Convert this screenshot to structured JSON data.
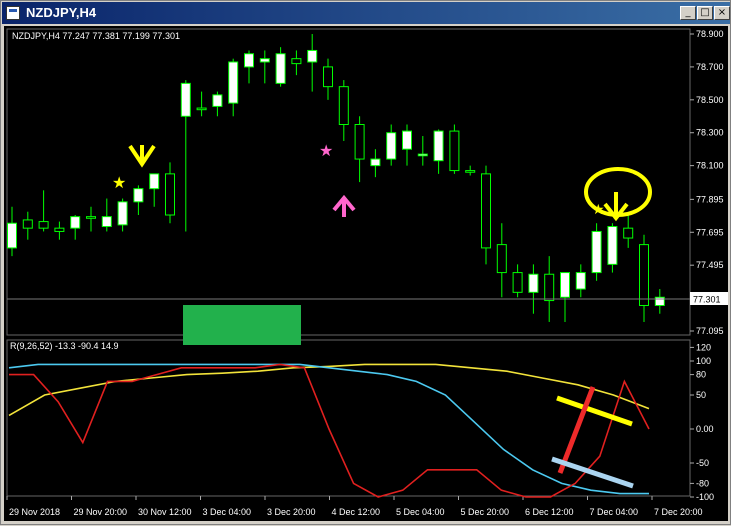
{
  "window": {
    "title": "NZDJPY,H4",
    "buttons": [
      "_",
      "□",
      "×"
    ]
  },
  "main_chart": {
    "header": "NZDJPY,H4  77.247 77.381 77.199 77.301",
    "current_price": "77.301",
    "price_axis": [
      "78.900",
      "78.700",
      "78.500",
      "78.300",
      "78.100",
      "77.895",
      "77.695",
      "77.495",
      "77.295",
      "77.095"
    ],
    "candles": [
      {
        "o": 77.6,
        "h": 77.85,
        "l": 77.55,
        "c": 77.75
      },
      {
        "o": 77.77,
        "h": 77.82,
        "l": 77.65,
        "c": 77.72
      },
      {
        "o": 77.76,
        "h": 77.95,
        "l": 77.7,
        "c": 77.72
      },
      {
        "o": 77.72,
        "h": 77.76,
        "l": 77.65,
        "c": 77.7
      },
      {
        "o": 77.72,
        "h": 77.8,
        "l": 77.65,
        "c": 77.79
      },
      {
        "o": 77.79,
        "h": 77.85,
        "l": 77.7,
        "c": 77.78
      },
      {
        "o": 77.73,
        "h": 77.9,
        "l": 77.7,
        "c": 77.79
      },
      {
        "o": 77.74,
        "h": 77.9,
        "l": 77.7,
        "c": 77.88
      },
      {
        "o": 77.88,
        "h": 77.98,
        "l": 77.8,
        "c": 77.96
      },
      {
        "o": 77.96,
        "h": 78.05,
        "l": 77.85,
        "c": 78.05
      },
      {
        "o": 78.05,
        "h": 78.12,
        "l": 77.75,
        "c": 77.8
      },
      {
        "o": 78.4,
        "h": 78.62,
        "l": 77.7,
        "c": 78.6
      },
      {
        "o": 78.45,
        "h": 78.55,
        "l": 78.4,
        "c": 78.44
      },
      {
        "o": 78.46,
        "h": 78.55,
        "l": 78.4,
        "c": 78.53
      },
      {
        "o": 78.48,
        "h": 78.75,
        "l": 78.4,
        "c": 78.73
      },
      {
        "o": 78.7,
        "h": 78.8,
        "l": 78.6,
        "c": 78.78
      },
      {
        "o": 78.73,
        "h": 78.8,
        "l": 78.6,
        "c": 78.75
      },
      {
        "o": 78.6,
        "h": 78.82,
        "l": 78.58,
        "c": 78.78
      },
      {
        "o": 78.75,
        "h": 78.8,
        "l": 78.65,
        "c": 78.72
      },
      {
        "o": 78.73,
        "h": 78.9,
        "l": 78.55,
        "c": 78.8
      },
      {
        "o": 78.7,
        "h": 78.75,
        "l": 78.5,
        "c": 78.58
      },
      {
        "o": 78.58,
        "h": 78.62,
        "l": 78.25,
        "c": 78.35
      },
      {
        "o": 78.35,
        "h": 78.4,
        "l": 78.0,
        "c": 78.14
      },
      {
        "o": 78.1,
        "h": 78.2,
        "l": 78.03,
        "c": 78.14
      },
      {
        "o": 78.14,
        "h": 78.35,
        "l": 78.1,
        "c": 78.3
      },
      {
        "o": 78.2,
        "h": 78.35,
        "l": 78.1,
        "c": 78.31
      },
      {
        "o": 78.16,
        "h": 78.28,
        "l": 78.1,
        "c": 78.17
      },
      {
        "o": 78.13,
        "h": 78.32,
        "l": 78.05,
        "c": 78.31
      },
      {
        "o": 78.31,
        "h": 78.35,
        "l": 78.05,
        "c": 78.07
      },
      {
        "o": 78.07,
        "h": 78.1,
        "l": 78.04,
        "c": 78.06
      },
      {
        "o": 78.05,
        "h": 78.1,
        "l": 77.5,
        "c": 77.6
      },
      {
        "o": 77.62,
        "h": 77.75,
        "l": 77.3,
        "c": 77.45
      },
      {
        "o": 77.45,
        "h": 77.5,
        "l": 77.3,
        "c": 77.33
      },
      {
        "o": 77.33,
        "h": 77.5,
        "l": 77.2,
        "c": 77.44
      },
      {
        "o": 77.44,
        "h": 77.55,
        "l": 77.15,
        "c": 77.28
      },
      {
        "o": 77.3,
        "h": 77.45,
        "l": 77.15,
        "c": 77.45
      },
      {
        "o": 77.35,
        "h": 77.5,
        "l": 77.3,
        "c": 77.45
      },
      {
        "o": 77.45,
        "h": 77.75,
        "l": 77.4,
        "c": 77.7
      },
      {
        "o": 77.5,
        "h": 77.75,
        "l": 77.45,
        "c": 77.73
      },
      {
        "o": 77.72,
        "h": 77.8,
        "l": 77.6,
        "c": 77.66
      },
      {
        "o": 77.62,
        "h": 77.68,
        "l": 77.15,
        "c": 77.25
      },
      {
        "o": 77.25,
        "h": 77.35,
        "l": 77.2,
        "c": 77.3
      }
    ]
  },
  "indicator": {
    "header": "R(9,26,52) -13.3 -90.4 14.9",
    "axis": [
      "120",
      "100",
      "80",
      "50",
      "0.00",
      "-50",
      "-80",
      "-100"
    ],
    "red_values": [
      80,
      80,
      40,
      -20,
      70,
      70,
      80,
      90,
      90,
      90,
      90,
      95,
      90,
      0,
      -80,
      -100,
      -90,
      -60,
      -60,
      -60,
      -90,
      -100,
      -100,
      -80,
      -40,
      70,
      0
    ],
    "cyan_values": [
      90,
      95,
      95,
      95,
      95,
      95,
      95,
      95,
      95,
      95,
      95,
      90,
      85,
      80,
      70,
      50,
      10,
      -30,
      -60,
      -80,
      -90,
      -95,
      -95
    ],
    "yellow_values": [
      20,
      50,
      60,
      70,
      75,
      80,
      82,
      85,
      90,
      92,
      95,
      95,
      95,
      90,
      85,
      75,
      65,
      50,
      30
    ]
  },
  "time_axis": [
    "29 Nov 2018",
    "29 Nov 20:00",
    "30 Nov 12:00",
    "3 Dec 04:00",
    "3 Dec 20:00",
    "4 Dec 12:00",
    "5 Dec 04:00",
    "5 Dec 20:00",
    "6 Dec 12:00",
    "7 Dec 04:00",
    "7 Dec 20:00"
  ],
  "colors": {
    "bull": "#ffffff",
    "bear": "#000000",
    "wick": "#00ff00",
    "grid": "#333333",
    "annotation_yellow": "#ffff00",
    "annotation_pink": "#ff66cc",
    "green_box": "#22b14c",
    "red_line": "#e0201f",
    "cyan_line": "#4cc9f0",
    "yellow_line": "#f2e33a"
  }
}
